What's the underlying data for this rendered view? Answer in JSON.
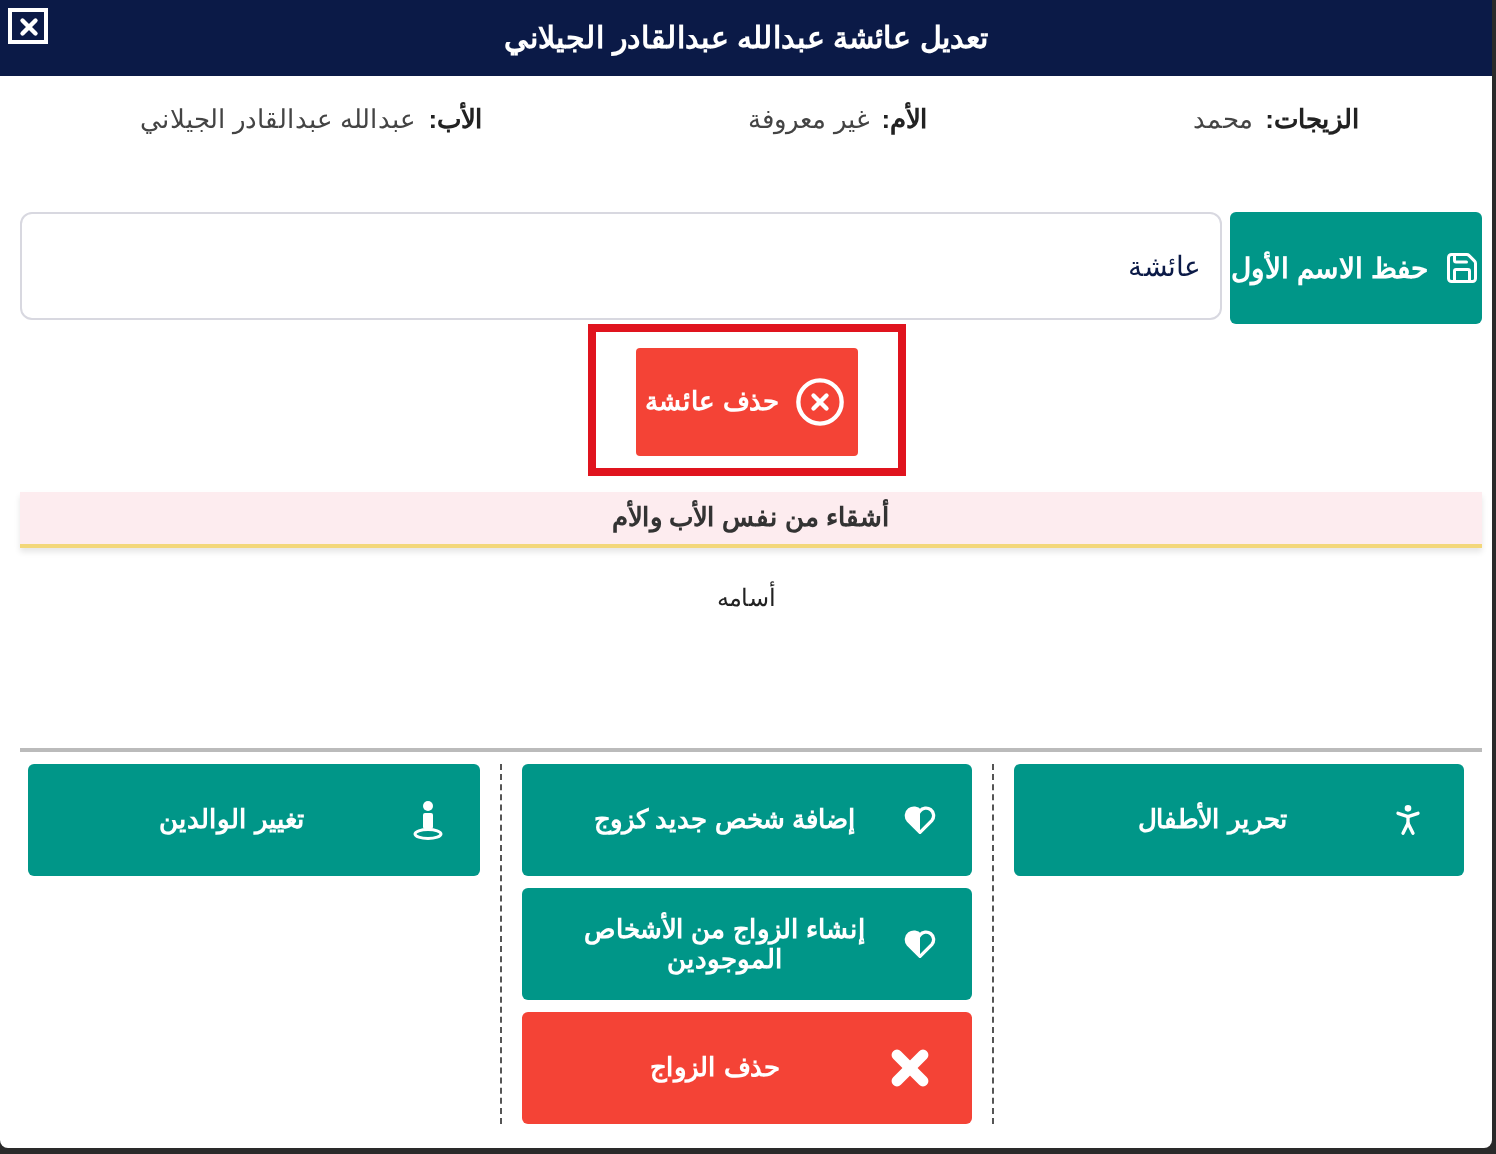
{
  "dialog": {
    "title": "تعديل عائشة عبدالله عبدالقادر الجيلاني"
  },
  "info": [
    {
      "label": "الزيجات:",
      "value": "محمد"
    },
    {
      "label": "الأم:",
      "value": "غير معروفة"
    },
    {
      "label": "الأب:",
      "value": "عبدالله عبدالقادر الجيلاني"
    }
  ],
  "first_name": {
    "value": "عائشة",
    "save_button": "حفظ الاسم الأول"
  },
  "delete_person": {
    "label": "حذف عائشة",
    "highlighted": true
  },
  "siblings": {
    "title": "أشقاء من نفس الأب والأم",
    "items": [
      "أسامه"
    ]
  },
  "action_columns": [
    [
      {
        "label": "تحرير الأطفال",
        "kind": "children"
      }
    ],
    [
      {
        "label": "إضافة شخص جديد كزوج",
        "kind": "spouse"
      },
      {
        "label": "إنشاء الزواج من الأشخاص الموجودين",
        "kind": "spouse"
      },
      {
        "label": "حذف الزواج",
        "kind": "delete"
      }
    ],
    [
      {
        "label": "تغيير الوالدين",
        "kind": "parents"
      }
    ]
  ]
}
